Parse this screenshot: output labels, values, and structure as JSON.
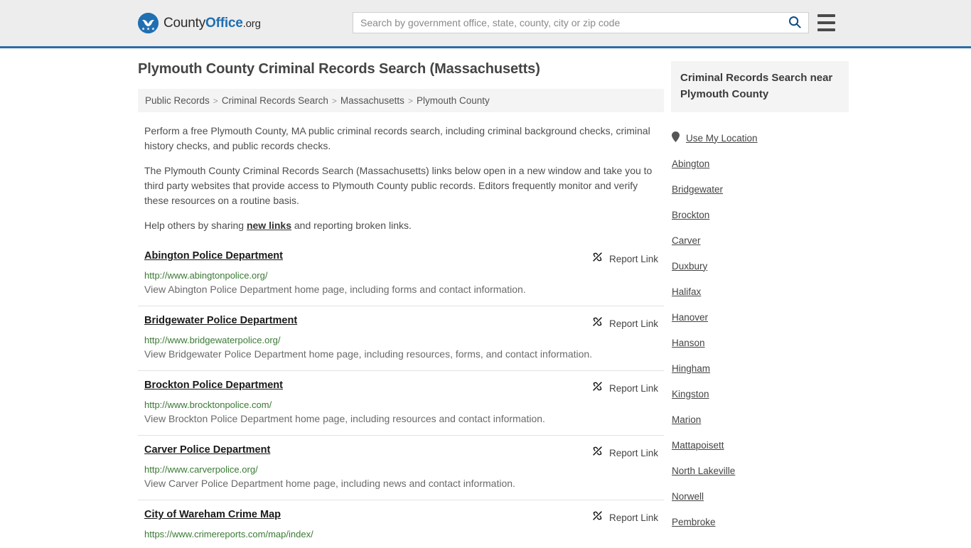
{
  "header": {
    "brand": {
      "part1": "County",
      "part2": "Office",
      "part3": ".org",
      "logo_icon": "eagle-shield-logo"
    },
    "search": {
      "placeholder": "Search by government office, state, county, city or zip code",
      "value": "",
      "icon": "search-icon"
    },
    "menu_icon": "hamburger-menu-icon",
    "accent_color": "#1f6fb2"
  },
  "main": {
    "title": "Plymouth County Criminal Records Search (Massachusetts)",
    "breadcrumb": [
      "Public Records",
      "Criminal Records Search",
      "Massachusetts",
      "Plymouth County"
    ],
    "breadcrumb_separator": ">",
    "intro": {
      "p1": "Perform a free Plymouth County, MA public criminal records search, including criminal background checks, criminal history checks, and public records checks.",
      "p2": "The Plymouth County Criminal Records Search (Massachusetts) links below open in a new window and take you to third party websites that provide access to Plymouth County public records. Editors frequently monitor and verify these resources on a routine basis.",
      "p3_before": "Help others by sharing ",
      "p3_link": "new links",
      "p3_after": " and reporting broken links."
    },
    "report_link_label": "Report Link",
    "report_link_icon": "broken-link-icon",
    "listings": [
      {
        "title": "Abington Police Department",
        "url": "http://www.abingtonpolice.org/",
        "description": "View Abington Police Department home page, including forms and contact information."
      },
      {
        "title": "Bridgewater Police Department",
        "url": "http://www.bridgewaterpolice.org/",
        "description": "View Bridgewater Police Department home page, including resources, forms, and contact information."
      },
      {
        "title": "Brockton Police Department",
        "url": "http://www.brocktonpolice.com/",
        "description": "View Brockton Police Department home page, including resources and contact information."
      },
      {
        "title": "Carver Police Department",
        "url": "http://www.carverpolice.org/",
        "description": "View Carver Police Department home page, including news and contact information."
      },
      {
        "title": "City of Wareham Crime Map",
        "url": "https://www.crimereports.com/map/index/",
        "description": ""
      }
    ]
  },
  "sidebar": {
    "heading": "Criminal Records Search near Plymouth County",
    "use_my_location": {
      "label": "Use My Location",
      "icon": "map-pin-icon"
    },
    "places": [
      "Abington",
      "Bridgewater",
      "Brockton",
      "Carver",
      "Duxbury",
      "Halifax",
      "Hanover",
      "Hanson",
      "Hingham",
      "Kingston",
      "Marion",
      "Mattapoisett",
      "North Lakeville",
      "Norwell",
      "Pembroke"
    ]
  }
}
